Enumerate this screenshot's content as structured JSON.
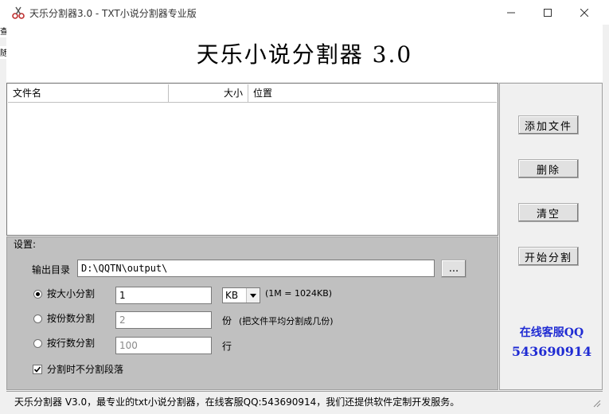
{
  "window": {
    "title": "天乐分割器3.0 - TXT小说分割器专业版",
    "behind_text_1": "查",
    "behind_text_2": "随"
  },
  "header": {
    "title": "天乐小说分割器 3.0"
  },
  "list": {
    "columns": [
      "文件名",
      "大小",
      "位置"
    ]
  },
  "buttons": {
    "add_file": "添加文件",
    "delete": "删除",
    "clear": "清空",
    "start_split": "开始分割",
    "browse": "..."
  },
  "support": {
    "label": "在线客服QQ",
    "qq": "543690914"
  },
  "settings": {
    "section_label": "设置:",
    "output_dir_label": "输出目录",
    "output_dir_value": "D:\\QQTN\\output\\",
    "by_size_label": "按大小分割",
    "by_size_value": "1",
    "size_unit": "KB",
    "size_hint": "(1M = 1024KB)",
    "by_parts_label": "按份数分割",
    "by_parts_value": "2",
    "parts_unit": "份",
    "parts_hint": "(把文件平均分割成几份)",
    "by_lines_label": "按行数分割",
    "by_lines_value": "100",
    "lines_unit": "行",
    "no_split_paragraph_label": "分割时不分割段落",
    "selected_mode": "by_size",
    "no_split_paragraph_checked": true
  },
  "status": {
    "text": "天乐分割器 V3.0，最专业的txt小说分割器，在线客服QQ:543690914，我们还提供软件定制开发服务。"
  }
}
